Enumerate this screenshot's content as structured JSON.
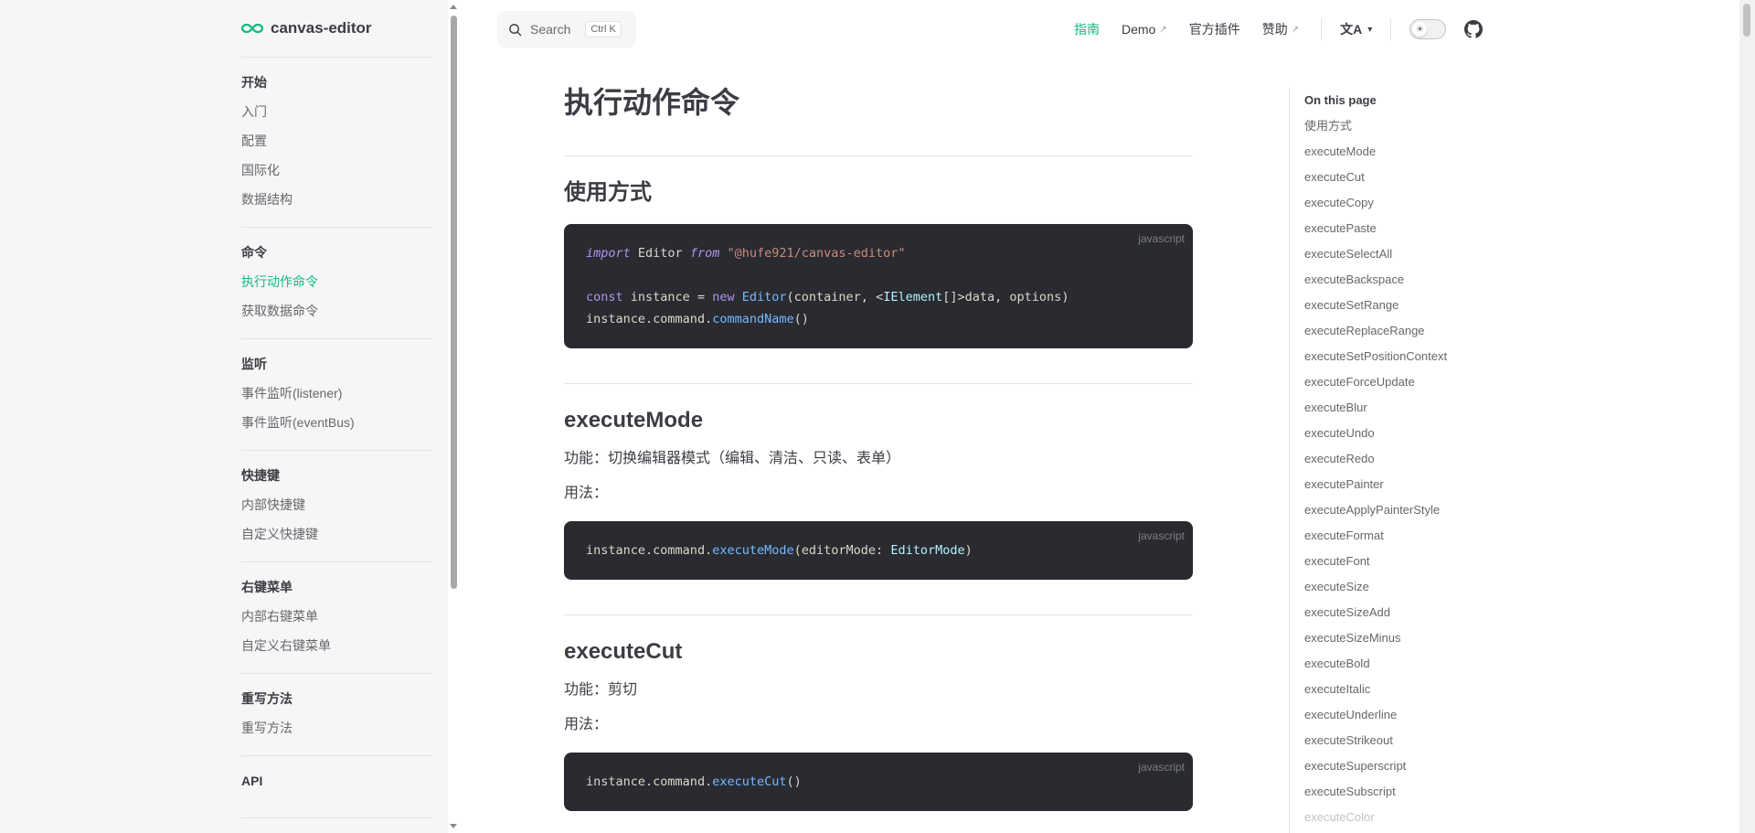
{
  "sidebar": {
    "brand": "canvas-editor",
    "groups": [
      {
        "title": "开始",
        "items": [
          {
            "label": "入门"
          },
          {
            "label": "配置"
          },
          {
            "label": "国际化"
          },
          {
            "label": "数据结构"
          }
        ]
      },
      {
        "title": "命令",
        "items": [
          {
            "label": "执行动作命令",
            "active": true
          },
          {
            "label": "获取数据命令"
          }
        ]
      },
      {
        "title": "监听",
        "items": [
          {
            "label": "事件监听(listener)"
          },
          {
            "label": "事件监听(eventBus)"
          }
        ]
      },
      {
        "title": "快捷键",
        "items": [
          {
            "label": "内部快捷键"
          },
          {
            "label": "自定义快捷键"
          }
        ]
      },
      {
        "title": "右键菜单",
        "items": [
          {
            "label": "内部右键菜单"
          },
          {
            "label": "自定义右键菜单"
          }
        ]
      },
      {
        "title": "重写方法",
        "items": [
          {
            "label": "重写方法"
          }
        ]
      },
      {
        "title": "API",
        "items": []
      }
    ]
  },
  "topnav": {
    "search_label": "Search",
    "search_kbd": "Ctrl K",
    "links": [
      {
        "label": "指南",
        "active": true,
        "external": false
      },
      {
        "label": "Demo",
        "active": false,
        "external": true
      },
      {
        "label": "官方插件",
        "active": false,
        "external": false
      },
      {
        "label": "赞助",
        "active": false,
        "external": true
      }
    ],
    "external_glyph": "↗",
    "translate_glyph": "文A",
    "theme_toggle": "light",
    "github_icon": "github-icon"
  },
  "main": {
    "title": "执行动作命令",
    "sections": {
      "usage": {
        "heading": "使用方式",
        "lang": "javascript"
      },
      "mode": {
        "heading": "executeMode",
        "desc": "功能：切换编辑器模式（编辑、清洁、只读、表单）",
        "usage_label": "用法：",
        "lang": "javascript"
      },
      "cut": {
        "heading": "executeCut",
        "desc": "功能：剪切",
        "usage_label": "用法：",
        "lang": "javascript"
      }
    }
  },
  "outline": {
    "title": "On this page",
    "items": [
      "使用方式",
      "executeMode",
      "executeCut",
      "executeCopy",
      "executePaste",
      "executeSelectAll",
      "executeBackspace",
      "executeSetRange",
      "executeReplaceRange",
      "executeSetPositionContext",
      "executeForceUpdate",
      "executeBlur",
      "executeUndo",
      "executeRedo",
      "executePainter",
      "executeApplyPainterStyle",
      "executeFormat",
      "executeFont",
      "executeSize",
      "executeSizeAdd",
      "executeSizeMinus",
      "executeBold",
      "executeItalic",
      "executeUnderline",
      "executeStrikeout",
      "executeSuperscript",
      "executeSubscript",
      "executeColor"
    ]
  },
  "colors": {
    "accent": "#10b981",
    "code_bg": "#292b30",
    "sidebar_bg": "#f6f6f7"
  }
}
